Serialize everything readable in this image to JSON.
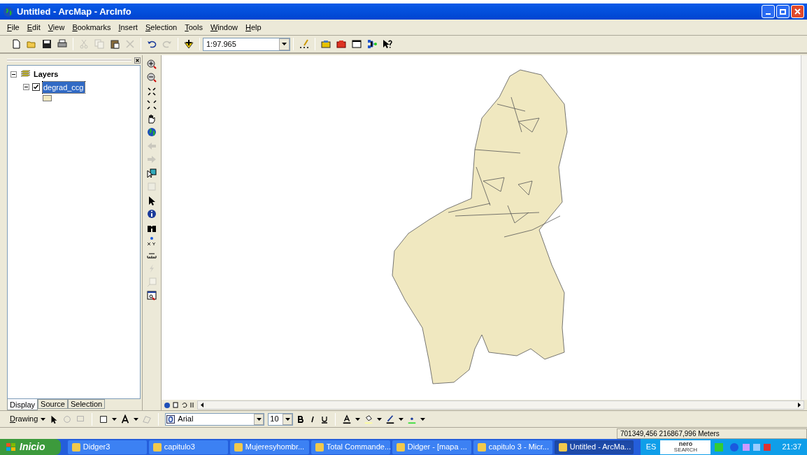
{
  "window": {
    "title": "Untitled - ArcMap - ArcInfo"
  },
  "menu": [
    "File",
    "Edit",
    "View",
    "Bookmarks",
    "Insert",
    "Selection",
    "Tools",
    "Window",
    "Help"
  ],
  "toolbar": {
    "buttons": [
      {
        "disabled": false
      },
      {
        "disabled": false
      },
      {
        "disabled": false
      },
      {
        "disabled": false
      },
      {
        "disabled": true
      },
      {
        "disabled": true
      },
      {
        "disabled": false
      },
      {
        "disabled": true
      },
      {
        "disabled": false
      },
      {
        "disabled": true
      },
      {
        "disabled": false
      }
    ],
    "scale": "1:97.965",
    "buttons_right": [
      {
        "disabled": false
      },
      {
        "disabled": false
      },
      {
        "disabled": false
      },
      {
        "disabled": false
      },
      {
        "disabled": false
      },
      {
        "disabled": false
      }
    ]
  },
  "toc": {
    "root": {
      "label": "Layers",
      "expanded": true
    },
    "layers": [
      {
        "name": "degrad_ccg",
        "visible": true,
        "selected": true,
        "expanded": true,
        "color": "#f0e8c0"
      }
    ],
    "tabs": [
      {
        "label": "Display",
        "selected": true
      },
      {
        "label": "Source",
        "selected": false
      },
      {
        "label": "Selection",
        "selected": false
      }
    ]
  },
  "tools": [
    {
      "disabled": false
    },
    {
      "disabled": false
    },
    {
      "disabled": false
    },
    {
      "disabled": false
    },
    {
      "disabled": false
    },
    {
      "disabled": false
    },
    {
      "disabled": true
    },
    {
      "disabled": true
    },
    {
      "disabled": false
    },
    {
      "disabled": true
    },
    {
      "disabled": false
    },
    {
      "disabled": false
    },
    {
      "disabled": false
    },
    {
      "disabled": false
    },
    {
      "disabled": false
    },
    {
      "disabled": true
    },
    {
      "disabled": true
    },
    {
      "disabled": false
    }
  ],
  "drawing": {
    "label": "Drawing",
    "font": "Arial",
    "size": "10"
  },
  "status_bar": {
    "coordinates": "701349,456 216867,996 Meters"
  },
  "taskbar": {
    "start": "Inicio",
    "items": [
      {
        "label": "Didger3",
        "selected": false
      },
      {
        "label": "capitulo3",
        "selected": false
      },
      {
        "label": "Mujeresyhombr...",
        "selected": false
      },
      {
        "label": "Total Commande...",
        "selected": false
      },
      {
        "label": "Didger - [mapa ...",
        "selected": false
      },
      {
        "label": "capitulo 3 - Micr...",
        "selected": false
      },
      {
        "label": "Untitled - ArcMa...",
        "selected": true
      }
    ],
    "language": "ES",
    "logo_top": "nero",
    "logo_bottom": "SEARCH",
    "clock": "21:37"
  }
}
